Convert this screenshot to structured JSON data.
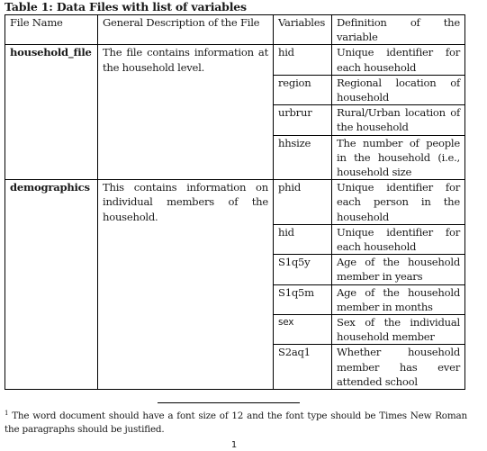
{
  "document": {
    "caption": "Table 1: Data Files with list of variables",
    "table": {
      "headers": {
        "file_name": "File Name",
        "description": "General Description of the File",
        "variables": "Variables",
        "definition": "Definition of the variable"
      },
      "files": [
        {
          "name": "household_file",
          "description": "The file contains information at the household level.",
          "variables": [
            {
              "name": "hid",
              "definition": "Unique identifier for each household"
            },
            {
              "name": "region",
              "definition": "Regional location of household"
            },
            {
              "name": "urbrur",
              "definition": "Rural/Urban location of the household"
            },
            {
              "name": "hhsize",
              "definition": "The number of people in the household (i.e., household size"
            }
          ]
        },
        {
          "name": "demographics",
          "description": "This contains information on individual members of the household.",
          "variables": [
            {
              "name": "phid",
              "definition": "Unique identifier for each person in the household"
            },
            {
              "name": "hid",
              "definition": "Unique identifier for each household"
            },
            {
              "name": "S1q5y",
              "definition": "Age of the household member in years"
            },
            {
              "name": "S1q5m",
              "definition": "Age of the household member in months"
            },
            {
              "name": "sex",
              "definition": "Sex of the individual household member"
            },
            {
              "name": "S2aq1",
              "definition": "Whether household member has ever attended school"
            }
          ]
        }
      ]
    },
    "footnote": {
      "marker": "1",
      "text": "The word document should have a font size of 12 and the font type should be Times New Roman the paragraphs should be justified."
    },
    "page_number": "1"
  }
}
